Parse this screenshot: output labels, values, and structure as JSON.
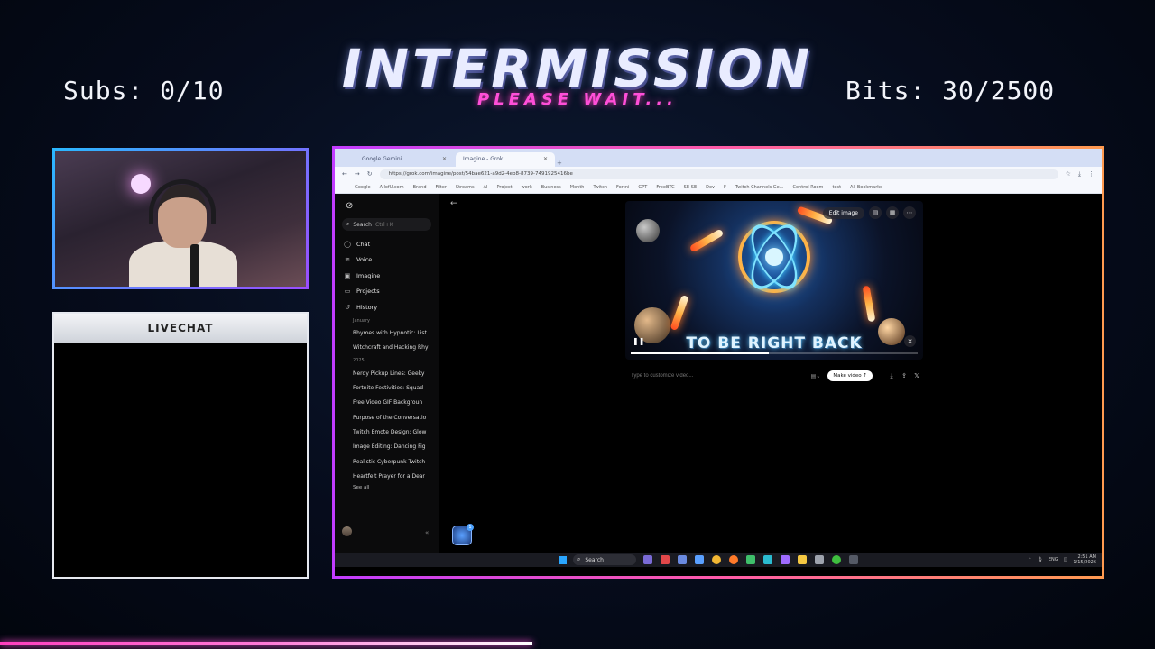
{
  "overlay": {
    "title": "INTERMISSION",
    "subtitle": "PLEASE WAIT...",
    "subs_label": "Subs: 0/10",
    "bits_label": "Bits: 30/2500",
    "livechat_title": "LIVECHAT"
  },
  "browser": {
    "tabs": [
      {
        "label": "Google Gemini",
        "active": false
      },
      {
        "label": "Imagine - Grok",
        "active": true
      }
    ],
    "url": "https://grok.com/imagine/post/54bae621-a9d2-4eb8-8739-7491925416be",
    "bookmarks": [
      "Google",
      "AllofU.com",
      "Brand",
      "Filter",
      "Streams",
      "AI",
      "Project",
      "work",
      "Business",
      "Month",
      "Twitch",
      "Fortni",
      "GPT",
      "FreeBTC",
      "SE-SE",
      "Dev",
      "F",
      "Twitch Channels Ge...",
      "Control Room",
      "test",
      "All Bookmarks"
    ]
  },
  "sidebar": {
    "search_label": "Search",
    "search_hint": "Ctrl+K",
    "nav": [
      {
        "label": "Chat",
        "icon": "chat-icon"
      },
      {
        "label": "Voice",
        "icon": "voice-icon"
      },
      {
        "label": "Imagine",
        "icon": "imagine-icon"
      },
      {
        "label": "Projects",
        "icon": "projects-icon"
      },
      {
        "label": "History",
        "icon": "history-icon"
      }
    ],
    "history": [
      {
        "group": "January",
        "items": [
          "Rhymes with Hypnotic: List",
          "Witchcraft and Hacking Rhy"
        ]
      },
      {
        "group": "2025",
        "items": [
          "Nerdy Pickup Lines: Geeky",
          "Fortnite Festivities: Squad",
          "Free Video GIF Backgroun",
          "Purpose of the Conversatio",
          "Twitch Emote Design: Glow",
          "Image Editing: Dancing Fig",
          "Realistic Cyberpunk Twitch",
          "Heartfelt Prayer for a Dear"
        ]
      }
    ],
    "see_all": "See all"
  },
  "video": {
    "caption": "TO BE RIGHT BACK",
    "edit_image_label": "Edit image",
    "progress_fraction": 0.48
  },
  "prompt": {
    "placeholder": "Type to customize video...",
    "make_video_label": "Make video"
  },
  "taskbar": {
    "search_label": "Search",
    "language": "ENG",
    "time": "2:51 AM",
    "date": "1/15/2026",
    "badge_count": "1"
  },
  "colors": {
    "title_glow": "#9aa8ff",
    "subtitle": "#ff4fd8",
    "frame_gradient_start": "#c23cff",
    "frame_gradient_end": "#ff9a50",
    "webcam_border": "#2ab8ff"
  }
}
